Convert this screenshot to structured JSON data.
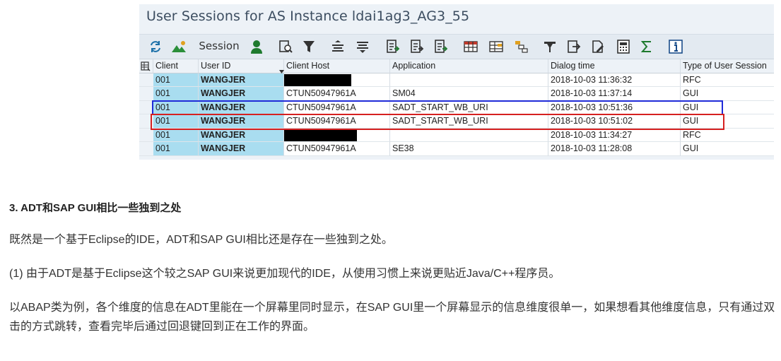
{
  "window": {
    "title": "User Sessions for AS Instance ldai1ag3_AG3_55"
  },
  "toolbar": {
    "session_label": "Session",
    "icons": [
      "refresh-icon",
      "mountain-icon",
      "session-label",
      "user-icon",
      "zoom-doc-icon",
      "filter-icon",
      "sort-asc-icon",
      "sort-desc-icon",
      "export-icon-1",
      "export-icon-2",
      "export-icon-3",
      "grid-icon",
      "layout-icon-1",
      "layout-icon-2",
      "print-icon",
      "send-icon",
      "edit-doc-icon",
      "calc-icon",
      "sum-icon",
      "info-icon"
    ]
  },
  "table": {
    "columns": [
      "Client",
      "User ID",
      "Client Host",
      "Application",
      "Dialog time",
      "Type of User Session"
    ],
    "rows": [
      {
        "client": "001",
        "user": "WANGJER",
        "host": "",
        "host_redacted": true,
        "app": "",
        "time": "2018-10-03 11:36:32",
        "type": "RFC"
      },
      {
        "client": "001",
        "user": "WANGJER",
        "host": "CTUN50947961A",
        "host_redacted": false,
        "app": "SM04",
        "time": "2018-10-03 11:37:14",
        "type": "GUI"
      },
      {
        "client": "001",
        "user": "WANGJER",
        "host": "CTUN50947961A",
        "host_redacted": false,
        "app": "SADT_START_WB_URI",
        "time": "2018-10-03 10:51:36",
        "type": "GUI"
      },
      {
        "client": "001",
        "user": "WANGJER",
        "host": "CTUN50947961A",
        "host_redacted": false,
        "app": "SADT_START_WB_URI",
        "time": "2018-10-03 10:51:02",
        "type": "GUI"
      },
      {
        "client": "001",
        "user": "WANGJER",
        "host": "",
        "host_redacted": true,
        "app": "",
        "time": "2018-10-03 11:34:27",
        "type": "RFC"
      },
      {
        "client": "001",
        "user": "WANGJER",
        "host": "CTUN50947961A",
        "host_redacted": false,
        "app": "SE38",
        "time": "2018-10-03 11:28:08",
        "type": "GUI"
      }
    ]
  },
  "article": {
    "heading": "3. ADT和SAP GUI相比一些独到之处",
    "p1": "既然是一个基于Eclipse的IDE，ADT和SAP GUI相比还是存在一些独到之处。",
    "p2": "(1) 由于ADT是基于Eclipse这个较之SAP GUI来说更加现代的IDE，从使用习惯上来说更贴近Java/C++程序员。",
    "p3": "以ABAP类为例，各个维度的信息在ADT里能在一个屏幕里同时显示，在SAP GUI里一个屏幕显示的信息维度很单一，如果想看其他维度信息，只有通过双击的方式跳转，查看完毕后通过回退键回到正在工作的界面。"
  },
  "colors": {
    "highlight_blue": "#1f2bd8",
    "highlight_red": "#d62020",
    "key_column_bg": "#a9ddf0"
  }
}
